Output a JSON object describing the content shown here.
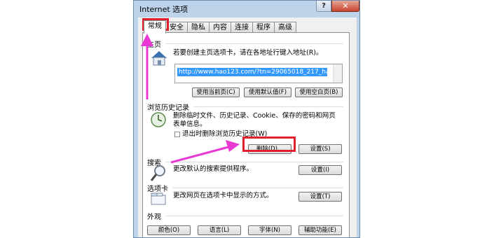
{
  "window": {
    "title": "Internet 选项",
    "help_glyph": "?",
    "close_glyph": "✕"
  },
  "tabs": [
    "常规",
    "安全",
    "隐私",
    "内容",
    "连接",
    "程序",
    "高级"
  ],
  "home": {
    "label": "主页",
    "desc": "若要创建主页选项卡，请在各地址行键入地址(R)。",
    "url": "http://www.hao123.com/?tn=29065018_217_hao",
    "btn_current": "使用当前页(C)",
    "btn_default": "使用默认值(F)",
    "btn_blank": "使用空白页(B)"
  },
  "history": {
    "label": "浏览历史记录",
    "desc_line1": "删除临时文件、历史记录、Cookie、保存的密码和网页",
    "desc_line2": "表单信息。",
    "checkbox": "退出时删除浏览历史记录(W)",
    "btn_delete": "删除(D)...",
    "btn_settings": "设置(S)"
  },
  "search": {
    "label": "搜索",
    "desc": "更改默认的搜索提供程序。",
    "btn_settings": "设置(I)"
  },
  "tabsection": {
    "label": "选项卡",
    "desc": "更改网页在选项卡中显示的方式。",
    "btn_settings": "设置(T)"
  },
  "appearance": {
    "label": "外观",
    "btn_colors": "颜色(O)",
    "btn_lang": "语言(L)",
    "btn_fonts": "字体(N)",
    "btn_access": "辅助功能(E)"
  },
  "colors": {
    "highlight": "#e0202c",
    "arrow": "#e83ad3",
    "selection": "#3399ff"
  }
}
